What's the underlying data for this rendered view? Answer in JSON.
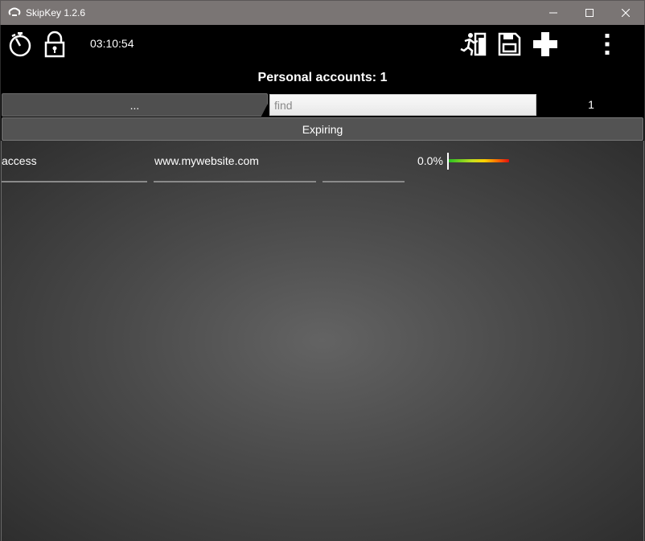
{
  "window": {
    "title": "SkipKey 1.2.6",
    "app_icon": "skipkey-logo-icon"
  },
  "toolbar": {
    "clock": "03:10:54",
    "icons": [
      "stopwatch-icon",
      "padlock-icon",
      "exit-running-icon",
      "save-floppy-icon",
      "plus-icon",
      "more-vertical-icon"
    ]
  },
  "heading": "Personal accounts: 1",
  "filter": {
    "category_label": "...",
    "search_placeholder": "find",
    "search_value": "",
    "count": "1"
  },
  "expiring_label": "Expiring",
  "entries": [
    {
      "name": "access",
      "url": "www.mywebsite.com",
      "extra": "",
      "strength": "0.0%",
      "strength_value": 0.0
    }
  ],
  "colors": {
    "background": "#000000",
    "content": "#4a4a4a",
    "titlebar": "#7a7574"
  }
}
